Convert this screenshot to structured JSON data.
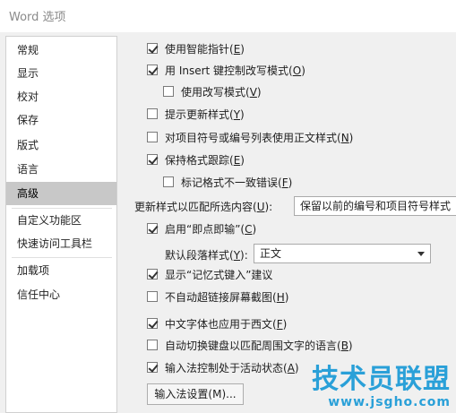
{
  "window": {
    "title": "Word 选项"
  },
  "sidebar": {
    "items": [
      {
        "label": "常规"
      },
      {
        "label": "显示"
      },
      {
        "label": "校对"
      },
      {
        "label": "保存"
      },
      {
        "label": "版式"
      },
      {
        "label": "语言"
      },
      {
        "label": "高级",
        "selected": true
      },
      {
        "label": "自定义功能区"
      },
      {
        "label": "快速访问工具栏"
      },
      {
        "label": "加载项"
      },
      {
        "label": "信任中心"
      }
    ]
  },
  "options": {
    "smart_pointer": {
      "label_pre": "使用智能指针(",
      "key": "E",
      "label_post": ")",
      "checked": true
    },
    "insert_key": {
      "label_pre": "用 Insert 键控制改写模式(",
      "key": "O",
      "label_post": ")",
      "checked": true
    },
    "overtype_mode": {
      "label_pre": "使用改写模式(",
      "key": "V",
      "label_post": ")",
      "checked": false
    },
    "prompt_update_style": {
      "label_pre": "提示更新样式(",
      "key": "Y",
      "label_post": ")",
      "checked": false
    },
    "normal_style_lists": {
      "label_pre": "对项目符号或编号列表使用正文样式(",
      "key": "N",
      "label_post": ")",
      "checked": false
    },
    "keep_format": {
      "label_pre": "保持格式跟踪(",
      "key": "E",
      "label_post": ")",
      "checked": true
    },
    "mark_format_inconsistency": {
      "label_pre": "标记格式不一致错误(",
      "key": "F",
      "label_post": ")",
      "checked": false
    },
    "update_style_match_label_pre": "更新样式以匹配所选内容(",
    "update_style_match_key": "U",
    "update_style_match_label_post": "):",
    "update_style_match_value": "保留以前的编号和项目符号样式",
    "click_and_type": {
      "label_pre": "启用“即点即输”(",
      "key": "C",
      "label_post": ")",
      "checked": true
    },
    "default_paragraph_label_pre": "默认段落样式(",
    "default_paragraph_key": "Y",
    "default_paragraph_label_post": "):",
    "default_paragraph_value": "正文",
    "autocomplete": {
      "label_pre": "显示“记忆式键入”建议",
      "key": "",
      "label_post": "",
      "checked": true
    },
    "no_hyperlink_screenshot": {
      "label_pre": "不自动超链接屏幕截图(",
      "key": "H",
      "label_post": ")",
      "checked": false
    },
    "cjk_font_western": {
      "label_pre": "中文字体也应用于西文(",
      "key": "F",
      "label_post": ")",
      "checked": true
    },
    "auto_keyboard": {
      "label_pre": "自动切换键盘以匹配周围文字的语言(",
      "key": "B",
      "label_post": ")",
      "checked": false
    },
    "ime_control": {
      "label_pre": "输入法控制处于活动状态(",
      "key": "A",
      "label_post": ")",
      "checked": true
    },
    "ime_settings_button": "输入法设置(M)..."
  },
  "watermark": {
    "main": "技术员联盟",
    "sub": "www.jsgho.com"
  },
  "colors": {
    "selected_nav": "#c8c8c8",
    "watermark": "#2aa0d8"
  }
}
